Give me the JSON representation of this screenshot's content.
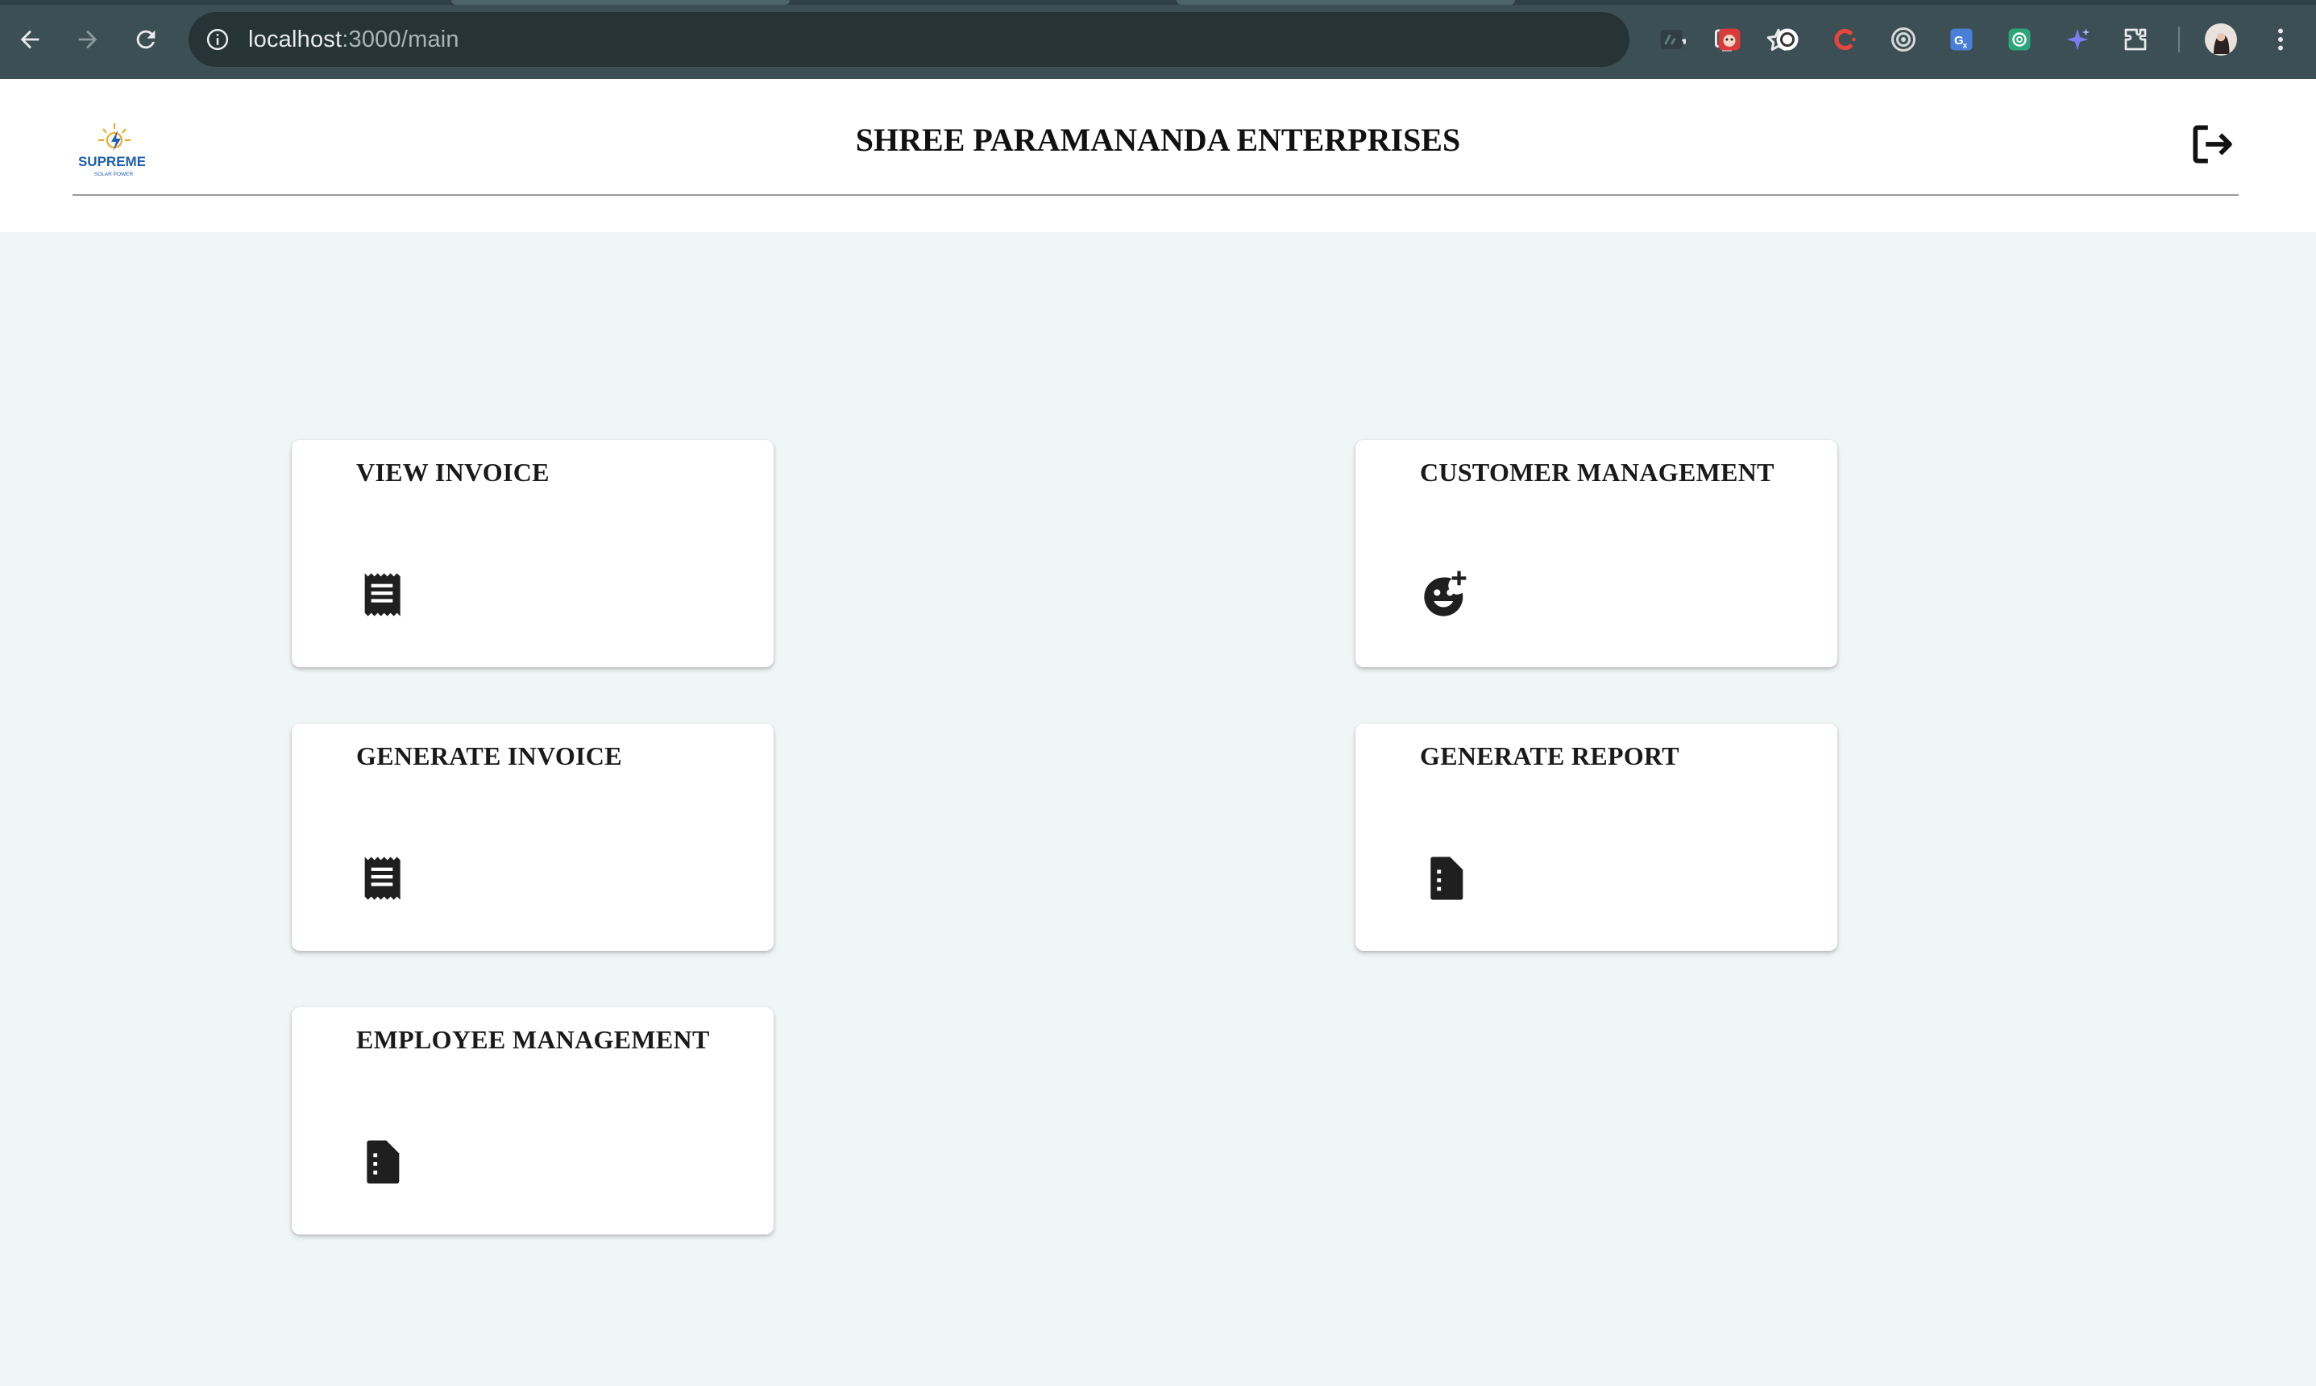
{
  "browser": {
    "url_host": "localhost",
    "url_path": ":3000/main",
    "extensions": [
      {
        "name": "tampermonkey-ext-icon",
        "color": "#2f3f43"
      },
      {
        "name": "redpanda-ext-icon",
        "color": "#d93a3a"
      },
      {
        "name": "circle-face-ext-icon",
        "color": "#ffffff"
      },
      {
        "name": "c-ext-icon",
        "color": "#e8453c"
      },
      {
        "name": "target-ext-icon",
        "color": "#d5d9da"
      },
      {
        "name": "google-translate-ext-icon",
        "color": "#4a7fd8"
      },
      {
        "name": "chatgpt-ext-icon",
        "color": "#2fa37a"
      },
      {
        "name": "sparkle-ext-icon",
        "color": "#7b7cf0"
      }
    ]
  },
  "header": {
    "title": "SHREE PARAMANANDA ENTERPRISES",
    "logo_text": "SUPREME",
    "logo_subtext": "SOLAR POWER"
  },
  "cards": [
    {
      "id": "view-invoice",
      "label": "VIEW INVOICE",
      "icon": "receipt-icon"
    },
    {
      "id": "customer-management",
      "label": "CUSTOMER MANAGEMENT",
      "icon": "add-reaction-icon"
    },
    {
      "id": "generate-invoice",
      "label": "GENERATE INVOICE",
      "icon": "receipt-icon"
    },
    {
      "id": "generate-report",
      "label": "GENERATE REPORT",
      "icon": "report-icon"
    },
    {
      "id": "employee-management",
      "label": "EMPLOYEE MANAGEMENT",
      "icon": "report-icon"
    }
  ],
  "colors": {
    "chrome_bg": "#3b4f54",
    "omnibox_bg": "#263438",
    "page_bg": "#f0f5f5",
    "card_bg": "#ffffff",
    "icon": "#1f1f1f"
  }
}
